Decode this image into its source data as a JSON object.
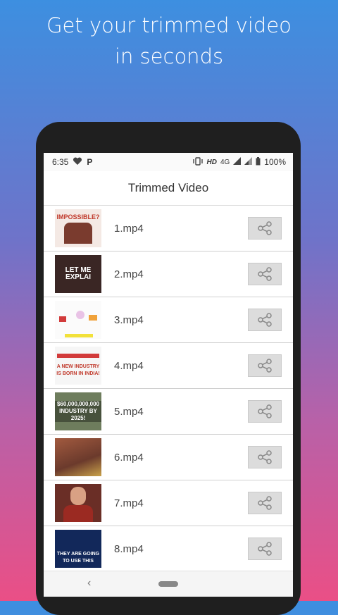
{
  "promo": {
    "line1": "Get your trimmed video",
    "line2": "in seconds"
  },
  "status_bar": {
    "time": "6:35",
    "left_icons": [
      "heart-icon",
      "p-icon"
    ],
    "right_icons": [
      "vibrate-icon",
      "hd-badge",
      "signal-icon",
      "signal-icon",
      "battery-icon"
    ],
    "hd": "HD",
    "network": "4G",
    "battery": "100%"
  },
  "app_bar": {
    "title": "Trimmed Video"
  },
  "videos": [
    {
      "name": "1.mp4",
      "thumb_text": "IMPOSSIBLE?",
      "thumb_bg": "#f4e9e4"
    },
    {
      "name": "2.mp4",
      "thumb_text": "LET ME EXPLAI",
      "thumb_bg": "#3a2624"
    },
    {
      "name": "3.mp4",
      "thumb_text": "",
      "thumb_bg": "#fbfbfb"
    },
    {
      "name": "4.mp4",
      "thumb_text": "A NEW INDUSTRY IS BORN IN INDIA!",
      "thumb_bg": "#f6f6f6"
    },
    {
      "name": "5.mp4",
      "thumb_text": "$60,000,000,000 INDUSTRY BY 2025!",
      "thumb_bg": "#6e7d5d"
    },
    {
      "name": "6.mp4",
      "thumb_text": "",
      "thumb_bg": "#8a4b3a"
    },
    {
      "name": "7.mp4",
      "thumb_text": "",
      "thumb_bg": "#6a2e26"
    },
    {
      "name": "8.mp4",
      "thumb_text": "THEY ARE GOING TO USE THIS",
      "thumb_bg": "#12285a"
    }
  ],
  "share_icon": "share-icon",
  "nav": {
    "back_icon": "back-icon",
    "home_icon": "home-pill-icon"
  }
}
